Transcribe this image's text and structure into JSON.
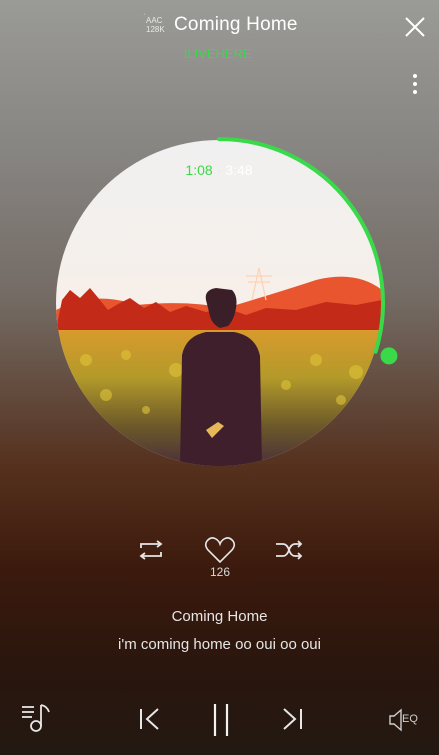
{
  "header": {
    "codec_format": "AAC",
    "codec_bitrate": "128K",
    "track_title": "Coming Home",
    "artist": "ILIVEHERE."
  },
  "player": {
    "current_time": "1:08",
    "separator": "·",
    "total_time": "3:48",
    "progress_fraction": 0.298,
    "like_count": "126"
  },
  "lyrics": {
    "title": "Coming Home",
    "current_line": "i'm coming home oo oui oo oui"
  },
  "controls": {
    "eq_label": "EQ"
  },
  "colors": {
    "accent": "#39d94a",
    "text": "#ffffff"
  },
  "icons": {
    "close": "close-icon",
    "more": "more-vertical-icon",
    "repeat": "repeat-icon",
    "like": "heart-icon",
    "shuffle": "shuffle-icon",
    "playlist": "playlist-music-icon",
    "previous": "skip-previous-icon",
    "pause": "pause-icon",
    "next": "skip-next-icon",
    "equalizer": "speaker-eq-icon"
  }
}
